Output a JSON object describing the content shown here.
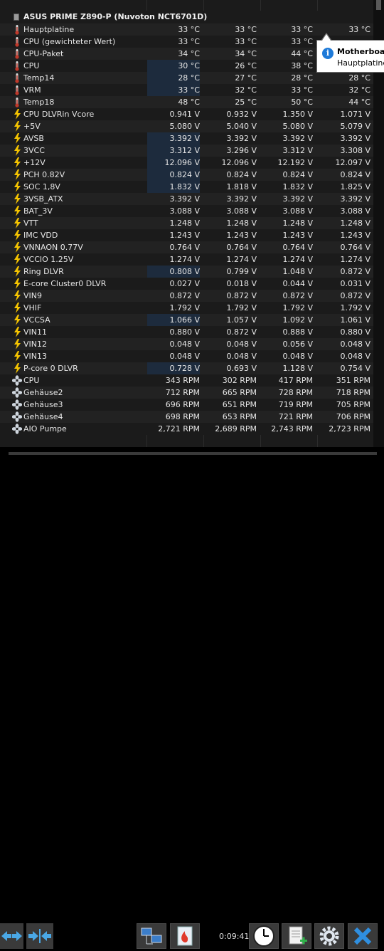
{
  "group": {
    "title": "ASUS PRIME Z890-P (Nuvoton NCT6701D)"
  },
  "rows": [
    {
      "icon": "thermometer-icon",
      "label": "Hauptplatine",
      "v": [
        "33 °C",
        "33 °C",
        "33 °C",
        "33 °C"
      ]
    },
    {
      "icon": "thermometer-icon",
      "label": "CPU (gewichteter Wert)",
      "v": [
        "33 °C",
        "33 °C",
        "33 °C",
        ""
      ]
    },
    {
      "icon": "thermometer-icon",
      "label": "CPU-Paket",
      "v": [
        "34 °C",
        "34 °C",
        "44 °C",
        ""
      ]
    },
    {
      "icon": "thermometer-icon",
      "label": "CPU",
      "v": [
        "30 °C",
        "26 °C",
        "38 °C",
        ""
      ]
    },
    {
      "icon": "thermometer-icon",
      "label": "Temp14",
      "v": [
        "28 °C",
        "27 °C",
        "28 °C",
        "28 °C"
      ]
    },
    {
      "icon": "thermometer-icon",
      "label": "VRM",
      "v": [
        "33 °C",
        "32 °C",
        "33 °C",
        "32 °C"
      ]
    },
    {
      "icon": "thermometer-icon",
      "label": "Temp18",
      "v": [
        "48 °C",
        "25 °C",
        "50 °C",
        "44 °C"
      ]
    },
    {
      "icon": "lightning-icon",
      "label": "CPU DLVRin Vcore",
      "v": [
        "0.941 V",
        "0.932 V",
        "1.350 V",
        "1.071 V"
      ]
    },
    {
      "icon": "lightning-icon",
      "label": "+5V",
      "v": [
        "5.080 V",
        "5.040 V",
        "5.080 V",
        "5.079 V"
      ]
    },
    {
      "icon": "lightning-icon",
      "label": "AVSB",
      "v": [
        "3.392 V",
        "3.392 V",
        "3.392 V",
        "3.392 V"
      ]
    },
    {
      "icon": "lightning-icon",
      "label": "3VCC",
      "v": [
        "3.312 V",
        "3.296 V",
        "3.312 V",
        "3.308 V"
      ]
    },
    {
      "icon": "lightning-icon",
      "label": "+12V",
      "v": [
        "12.096 V",
        "12.096 V",
        "12.192 V",
        "12.097 V"
      ]
    },
    {
      "icon": "lightning-icon",
      "label": "PCH 0.82V",
      "v": [
        "0.824 V",
        "0.824 V",
        "0.824 V",
        "0.824 V"
      ]
    },
    {
      "icon": "lightning-icon",
      "label": "SOC 1,8V",
      "v": [
        "1.832 V",
        "1.818 V",
        "1.832 V",
        "1.825 V"
      ]
    },
    {
      "icon": "lightning-icon",
      "label": "3VSB_ATX",
      "v": [
        "3.392 V",
        "3.392 V",
        "3.392 V",
        "3.392 V"
      ]
    },
    {
      "icon": "lightning-icon",
      "label": "BAT_3V",
      "v": [
        "3.088 V",
        "3.088 V",
        "3.088 V",
        "3.088 V"
      ]
    },
    {
      "icon": "lightning-icon",
      "label": "VTT",
      "v": [
        "1.248 V",
        "1.248 V",
        "1.248 V",
        "1.248 V"
      ]
    },
    {
      "icon": "lightning-icon",
      "label": "IMC VDD",
      "v": [
        "1.243 V",
        "1.243 V",
        "1.243 V",
        "1.243 V"
      ]
    },
    {
      "icon": "lightning-icon",
      "label": "VNNAON 0.77V",
      "v": [
        "0.764 V",
        "0.764 V",
        "0.764 V",
        "0.764 V"
      ]
    },
    {
      "icon": "lightning-icon",
      "label": "VCCIO 1.25V",
      "v": [
        "1.274 V",
        "1.274 V",
        "1.274 V",
        "1.274 V"
      ]
    },
    {
      "icon": "lightning-icon",
      "label": "Ring DLVR",
      "v": [
        "0.808 V",
        "0.799 V",
        "1.048 V",
        "0.872 V"
      ]
    },
    {
      "icon": "lightning-icon",
      "label": "E-core Cluster0 DLVR",
      "v": [
        "0.027 V",
        "0.018 V",
        "0.044 V",
        "0.031 V"
      ]
    },
    {
      "icon": "lightning-icon",
      "label": "VIN9",
      "v": [
        "0.872 V",
        "0.872 V",
        "0.872 V",
        "0.872 V"
      ]
    },
    {
      "icon": "lightning-icon",
      "label": "VHIF",
      "v": [
        "1.792 V",
        "1.792 V",
        "1.792 V",
        "1.792 V"
      ]
    },
    {
      "icon": "lightning-icon",
      "label": "VCCSA",
      "v": [
        "1.066 V",
        "1.057 V",
        "1.092 V",
        "1.061 V"
      ]
    },
    {
      "icon": "lightning-icon",
      "label": "VIN11",
      "v": [
        "0.880 V",
        "0.872 V",
        "0.888 V",
        "0.880 V"
      ]
    },
    {
      "icon": "lightning-icon",
      "label": "VIN12",
      "v": [
        "0.048 V",
        "0.048 V",
        "0.056 V",
        "0.048 V"
      ]
    },
    {
      "icon": "lightning-icon",
      "label": "VIN13",
      "v": [
        "0.048 V",
        "0.048 V",
        "0.048 V",
        "0.048 V"
      ]
    },
    {
      "icon": "lightning-icon",
      "label": "P-core 0 DLVR",
      "v": [
        "0.728 V",
        "0.693 V",
        "1.128 V",
        "0.754 V"
      ]
    },
    {
      "icon": "fan-icon",
      "label": "CPU",
      "v": [
        "343 RPM",
        "302 RPM",
        "417 RPM",
        "351 RPM"
      ]
    },
    {
      "icon": "fan-icon",
      "label": "Gehäuse2",
      "v": [
        "712 RPM",
        "665 RPM",
        "728 RPM",
        "718 RPM"
      ]
    },
    {
      "icon": "fan-icon",
      "label": "Gehäuse3",
      "v": [
        "696 RPM",
        "651 RPM",
        "719 RPM",
        "705 RPM"
      ]
    },
    {
      "icon": "fan-icon",
      "label": "Gehäuse4",
      "v": [
        "698 RPM",
        "653 RPM",
        "721 RPM",
        "706 RPM"
      ]
    },
    {
      "icon": "fan-icon",
      "label": "AIO Pumpe",
      "v": [
        "2,721 RPM",
        "2,689 RPM",
        "2,743 RPM",
        "2,723 RPM"
      ]
    }
  ],
  "tooltip": {
    "title": "Motherboard",
    "subtitle": "Hauptplatine"
  },
  "toolbar": {
    "timer": "0:09:41"
  },
  "colors": {
    "accent": "#1e7ad8",
    "highlight_cell": "#1d2b3d",
    "thermometer": "#c0392b",
    "lightning": "#f5c400",
    "fan": "#cfd6de"
  }
}
